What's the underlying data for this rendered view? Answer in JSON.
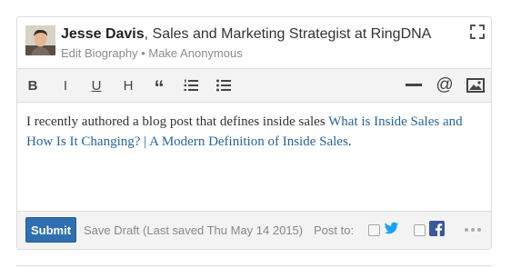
{
  "author": {
    "name": "Jesse Davis",
    "title": ", Sales and Marketing Strategist at RingDNA",
    "edit_biography": "Edit Biography",
    "separator": "•",
    "make_anonymous": "Make Anonymous"
  },
  "toolbar": {
    "bold": "B",
    "italic": "I",
    "underline": "U",
    "heading": "H",
    "quote": "“",
    "at": "@"
  },
  "editor": {
    "text": "I recently authored a blog post that defines inside sales ",
    "link_text": "What is Inside Sales and How Is It Changing? | A Modern Definition of Inside Sales",
    "trailing": "."
  },
  "footer": {
    "submit_label": "Submit",
    "save_draft": "Save Draft (Last saved Thu May 14 2015)",
    "post_to": "Post to:",
    "twitter_icon": "twitter-icon",
    "facebook_icon": "facebook-icon"
  },
  "colors": {
    "submit": "#2f6fb0",
    "link": "#2a6496",
    "twitter": "#1da1f2",
    "facebook": "#3b5998"
  }
}
